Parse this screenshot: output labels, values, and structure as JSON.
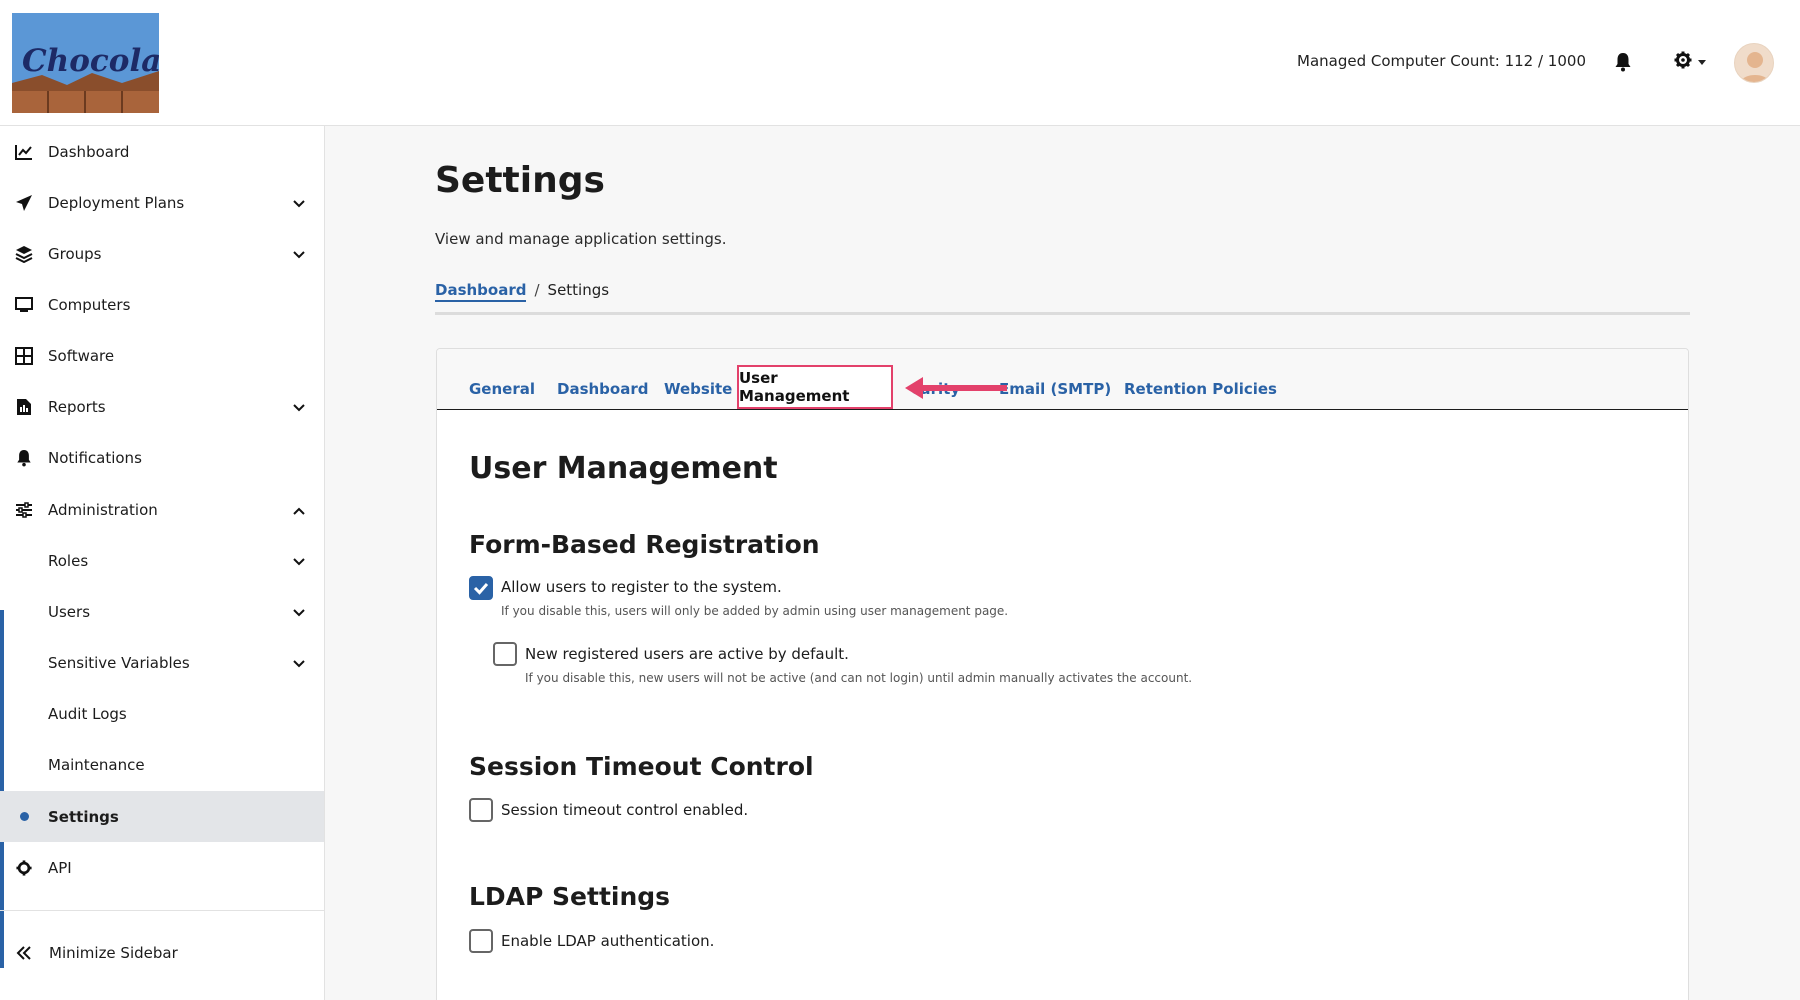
{
  "header": {
    "logo_text": "Chocolatey",
    "managed_count": "Managed Computer Count: 112 / 1000",
    "icons": [
      "bell-icon",
      "gear-icon",
      "avatar"
    ]
  },
  "sidebar": {
    "items": [
      {
        "label": "Dashboard",
        "icon": "chart-line-icon"
      },
      {
        "label": "Deployment Plans",
        "icon": "paper-plane-icon"
      },
      {
        "label": "Groups",
        "icon": "layers-icon"
      },
      {
        "label": "Computers",
        "icon": "monitor-icon"
      },
      {
        "label": "Software",
        "icon": "grid-icon"
      },
      {
        "label": "Reports",
        "icon": "report-icon"
      },
      {
        "label": "Notifications",
        "icon": "bell-icon"
      },
      {
        "label": "Administration",
        "icon": "sliders-icon"
      },
      {
        "label": "Roles"
      },
      {
        "label": "Users"
      },
      {
        "label": "Sensitive Variables"
      },
      {
        "label": "Audit Logs"
      },
      {
        "label": "Maintenance"
      },
      {
        "label": "Settings"
      },
      {
        "label": "API",
        "icon": "gear-icon"
      }
    ],
    "minimize_label": "Minimize Sidebar"
  },
  "main": {
    "title": "Settings",
    "subtitle": "View and manage application settings.",
    "breadcrumb": {
      "link": "Dashboard",
      "separator": "/",
      "current": "Settings"
    },
    "tabs": [
      "General",
      "Dashboard",
      "Website",
      "User Management",
      "Security",
      "Email (SMTP)",
      "Retention Policies"
    ],
    "active_tab": "User Management",
    "obscured_tab_fragment": "curity",
    "content": {
      "heading": "User Management",
      "form_registration": {
        "heading": "Form-Based Registration",
        "allow_register": {
          "label": "Allow users to register to the system.",
          "help": "If you disable this, users will only be added by admin using user management page.",
          "checked": true
        },
        "active_default": {
          "label": "New registered users are active by default.",
          "help": "If you disable this, new users will not be active (and can not login) until admin manually activates the account.",
          "checked": false
        }
      },
      "session_timeout": {
        "heading": "Session Timeout Control",
        "enabled": {
          "label": "Session timeout control enabled.",
          "checked": false
        }
      },
      "ldap": {
        "heading": "LDAP Settings",
        "enabled": {
          "label": "Enable LDAP authentication.",
          "checked": false
        }
      }
    }
  },
  "colors": {
    "accent": "#2a62a6",
    "highlight": "#e3416b",
    "active_bg": "#e3e5e8"
  }
}
